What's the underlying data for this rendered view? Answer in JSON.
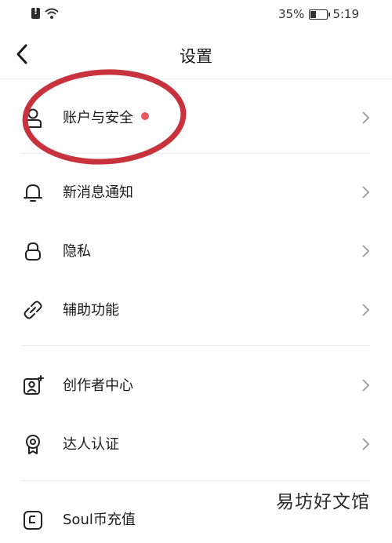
{
  "status_bar": {
    "battery_text": "35%",
    "battery_level": 0.35,
    "time": "5:19",
    "icons": [
      "sim-alert-icon",
      "wifi-icon",
      "battery-icon"
    ]
  },
  "header": {
    "title": "设置",
    "back_icon": "chevron-left-icon"
  },
  "settings": {
    "items": [
      {
        "label": "账户与安全",
        "icon": "user-icon",
        "has_badge": true,
        "badge_color": "#e8585f"
      },
      {
        "label": "新消息通知",
        "icon": "bell-icon"
      },
      {
        "label": "隐私",
        "icon": "lock-icon"
      },
      {
        "label": "辅助功能",
        "icon": "link-icon"
      },
      {
        "label": "创作者中心",
        "icon": "creator-icon"
      },
      {
        "label": "达人认证",
        "icon": "badge-award-icon"
      },
      {
        "label": "Soul币充值",
        "icon": "coin-icon"
      }
    ]
  },
  "annotation": {
    "shape": "ellipse",
    "color": "#c8323c"
  },
  "watermark": {
    "text": "易坊好文馆"
  }
}
